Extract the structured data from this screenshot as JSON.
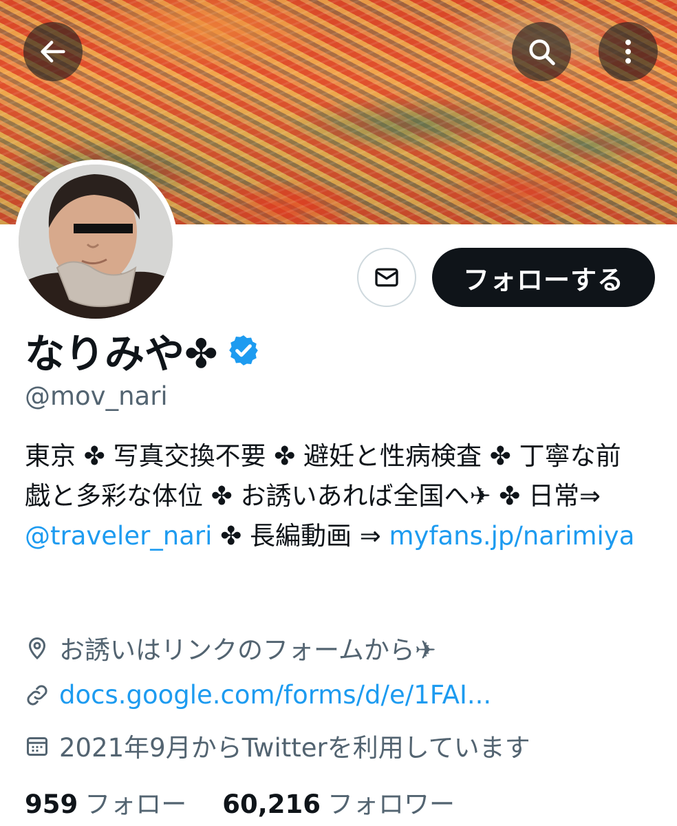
{
  "header": {
    "back_icon": "arrow-left-icon",
    "search_icon": "search-icon",
    "more_icon": "more-vertical-icon"
  },
  "actions": {
    "message_icon": "envelope-icon",
    "follow_label": "フォローする"
  },
  "profile": {
    "display_name": "なりみや✤",
    "verified_icon": "verified-badge-icon",
    "verified_color": "#1d9bf0",
    "handle": "@mov_nari",
    "bio": {
      "part1": "東京 ✤ 写真交換不要 ✤ 避妊と性病検査 ✤ 丁寧な前戯と多彩な体位 ✤ お誘いあれば全国へ✈ ✤ 日常⇒ ",
      "mention": "@traveler_nari",
      "part2": " ✤ 長編動画 ⇒ ",
      "link": "myfans.jp/narimiya"
    },
    "location": "お誘いはリンクのフォームから✈",
    "url": "docs.google.com/forms/d/e/1FAI...",
    "joined": "2021年9月からTwitterを利用しています"
  },
  "stats": {
    "following_count": "959",
    "following_label": "フォロー",
    "followers_count": "60,216",
    "followers_label": "フォロワー"
  },
  "colors": {
    "link": "#1d9bf0",
    "text": "#0f1419",
    "secondary": "#536471",
    "button_dark": "#0f1419"
  }
}
